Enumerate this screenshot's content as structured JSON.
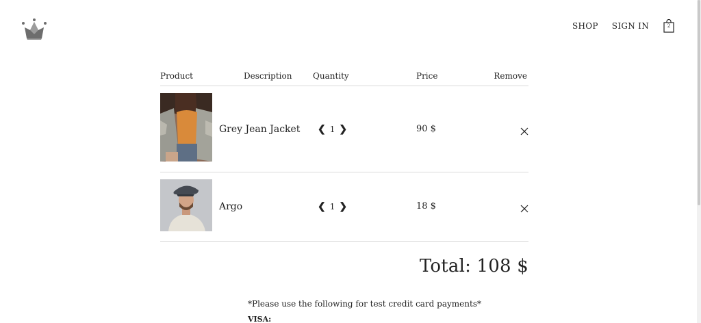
{
  "header": {
    "nav": {
      "shop": "SHOP",
      "sign_in": "SIGN IN"
    },
    "cart_count": "2"
  },
  "cart": {
    "columns": {
      "product": "Product",
      "description": "Description",
      "quantity": "Quantity",
      "price": "Price",
      "remove": "Remove"
    },
    "items": [
      {
        "name": "Grey Jean Jacket",
        "quantity": "1",
        "price": "90 $"
      },
      {
        "name": "Argo",
        "quantity": "1",
        "price": "18 $"
      }
    ],
    "total": "Total: 108 $"
  },
  "note": {
    "text": "*Please use the following for test credit card payments*",
    "visa": "VISA:"
  },
  "icons": {
    "logo": "crown-icon",
    "bag": "shopping-bag-icon",
    "decrease": "chevron-left-icon",
    "increase": "chevron-right-icon",
    "remove": "close-icon"
  },
  "colors": {
    "text": "#222222",
    "divider": "#d9d9d9",
    "logo": "#6d6d6d"
  }
}
